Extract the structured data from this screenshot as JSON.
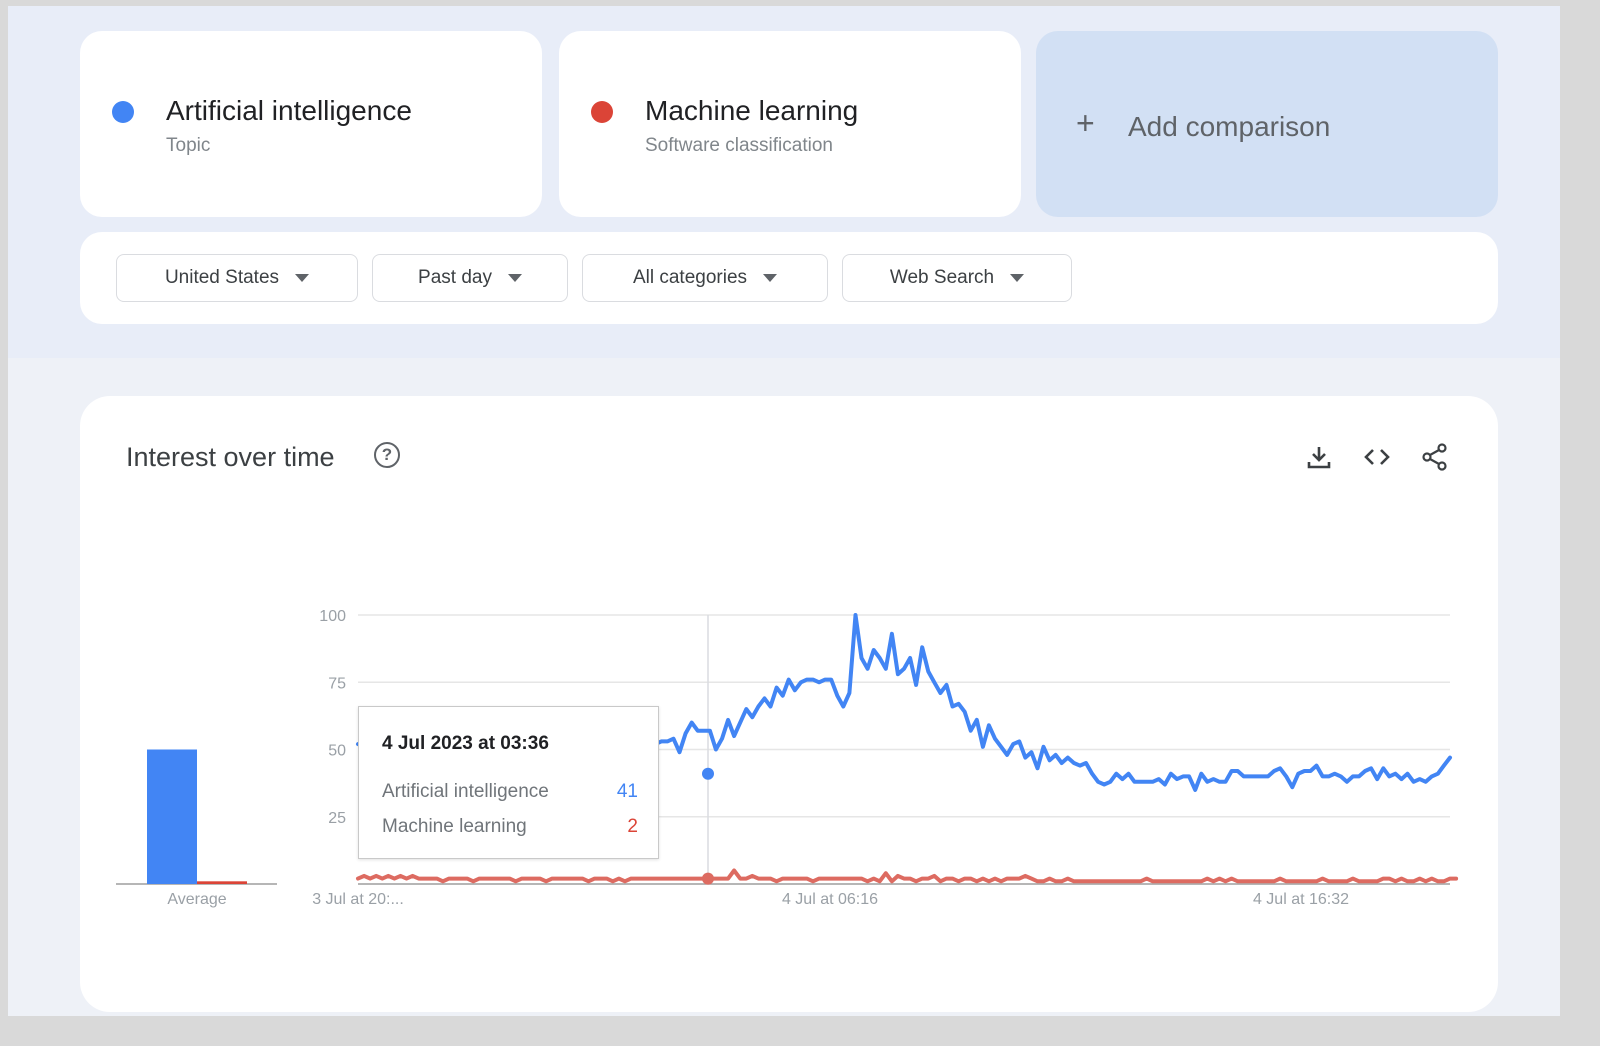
{
  "terms": [
    {
      "name": "Artificial intelligence",
      "type": "Topic",
      "color": "#4285f4"
    },
    {
      "name": "Machine learning",
      "type": "Software classification",
      "color": "#db4437"
    }
  ],
  "add_comparison": {
    "label": "Add comparison",
    "icon": "plus-icon"
  },
  "filters": [
    {
      "label": "United States",
      "icon": "caret-down-icon"
    },
    {
      "label": "Past day",
      "icon": "caret-down-icon"
    },
    {
      "label": "All categories",
      "icon": "caret-down-icon"
    },
    {
      "label": "Web Search",
      "icon": "caret-down-icon"
    }
  ],
  "panel": {
    "title": "Interest over time",
    "help_icon": "?",
    "actions": [
      "download-icon",
      "embed-code-icon",
      "share-icon"
    ]
  },
  "tooltip": {
    "title": "4 Jul 2023 at 03:36",
    "rows": [
      {
        "label": "Artificial intelligence",
        "value": "41",
        "color": "#4285f4"
      },
      {
        "label": "Machine learning",
        "value": "2",
        "color": "#db4437"
      }
    ]
  },
  "chart_data": {
    "type": "line",
    "title": "Interest over time",
    "xlabel": "",
    "ylabel": "",
    "ylim": [
      0,
      100
    ],
    "yticks": [
      25,
      50,
      75,
      100
    ],
    "grid": true,
    "x_tick_labels": [
      "3 Jul at 20:...",
      "4 Jul at 06:16",
      "4 Jul at 16:32"
    ],
    "x_tick_positions": [
      0,
      48,
      96
    ],
    "hover_index": 36,
    "average": {
      "label": "Average",
      "values": [
        {
          "name": "Artificial intelligence",
          "value": 50
        },
        {
          "name": "Machine learning",
          "value": 1
        }
      ]
    },
    "series": [
      {
        "name": "Artificial intelligence",
        "color": "#4285f4",
        "values": [
          52,
          51,
          52,
          49,
          50,
          47,
          50,
          48,
          47,
          46,
          47,
          46,
          47,
          45,
          46,
          44,
          46,
          44,
          46,
          42,
          45,
          44,
          44,
          43,
          45,
          43,
          44,
          42,
          44,
          41,
          44,
          43,
          41,
          42,
          45,
          44,
          41,
          43,
          45,
          47,
          49,
          45,
          50,
          47,
          51,
          49,
          53,
          51,
          47,
          52,
          53,
          53,
          54,
          49,
          56,
          60,
          57,
          57,
          57,
          50,
          54,
          61,
          55,
          60,
          65,
          62,
          66,
          69,
          66,
          73,
          70,
          76,
          72,
          75,
          76,
          76,
          75,
          76,
          76,
          70,
          66,
          71,
          100,
          84,
          80,
          87,
          84,
          80,
          93,
          78,
          80,
          84,
          74,
          88,
          79,
          75,
          71,
          74,
          66,
          67,
          64,
          57,
          61,
          51,
          59,
          54,
          51,
          48,
          52,
          53,
          47,
          49,
          43,
          51,
          46,
          48,
          45,
          47,
          45,
          44,
          45,
          41,
          38,
          37,
          38,
          41,
          39,
          41,
          38,
          38,
          38,
          38,
          39,
          37,
          41,
          39,
          40,
          40,
          35,
          41,
          38,
          39,
          38,
          38,
          42,
          42,
          40,
          40,
          40,
          40,
          40,
          42,
          43,
          40,
          36,
          41,
          42,
          42,
          44,
          40,
          40,
          41,
          40,
          38,
          40,
          40,
          42,
          43,
          39,
          43,
          40,
          41,
          39,
          41,
          38,
          39,
          38,
          40,
          41,
          44,
          47
        ]
      },
      {
        "name": "Machine learning",
        "color": "#db4437",
        "values": [
          2,
          3,
          2,
          3,
          2,
          3,
          2,
          3,
          2,
          3,
          2,
          2,
          2,
          2,
          1,
          2,
          2,
          2,
          2,
          1,
          2,
          2,
          2,
          2,
          2,
          2,
          1,
          2,
          2,
          2,
          2,
          1,
          2,
          2,
          2,
          2,
          2,
          2,
          1,
          2,
          2,
          2,
          1,
          2,
          1,
          2,
          2,
          2,
          2,
          2,
          2,
          2,
          2,
          2,
          2,
          2,
          2,
          2,
          2,
          2,
          2,
          2,
          5,
          2,
          2,
          3,
          2,
          2,
          2,
          1,
          2,
          2,
          2,
          2,
          2,
          1,
          2,
          2,
          2,
          2,
          2,
          2,
          2,
          2,
          1,
          2,
          1,
          4,
          1,
          3,
          2,
          2,
          1,
          2,
          2,
          3,
          1,
          2,
          2,
          1,
          2,
          2,
          1,
          2,
          1,
          2,
          1,
          2,
          2,
          2,
          3,
          2,
          1,
          1,
          2,
          1,
          1,
          2,
          1,
          1,
          1,
          1,
          1,
          1,
          1,
          1,
          1,
          1,
          1,
          1,
          2,
          1,
          1,
          1,
          1,
          1,
          1,
          1,
          1,
          1,
          2,
          1,
          2,
          1,
          2,
          1,
          1,
          1,
          1,
          1,
          1,
          1,
          2,
          1,
          1,
          1,
          1,
          1,
          1,
          2,
          1,
          1,
          1,
          1,
          2,
          1,
          1,
          1,
          1,
          2,
          2,
          1,
          2,
          1,
          1,
          2,
          1,
          2,
          1,
          1,
          2,
          2
        ]
      }
    ]
  }
}
